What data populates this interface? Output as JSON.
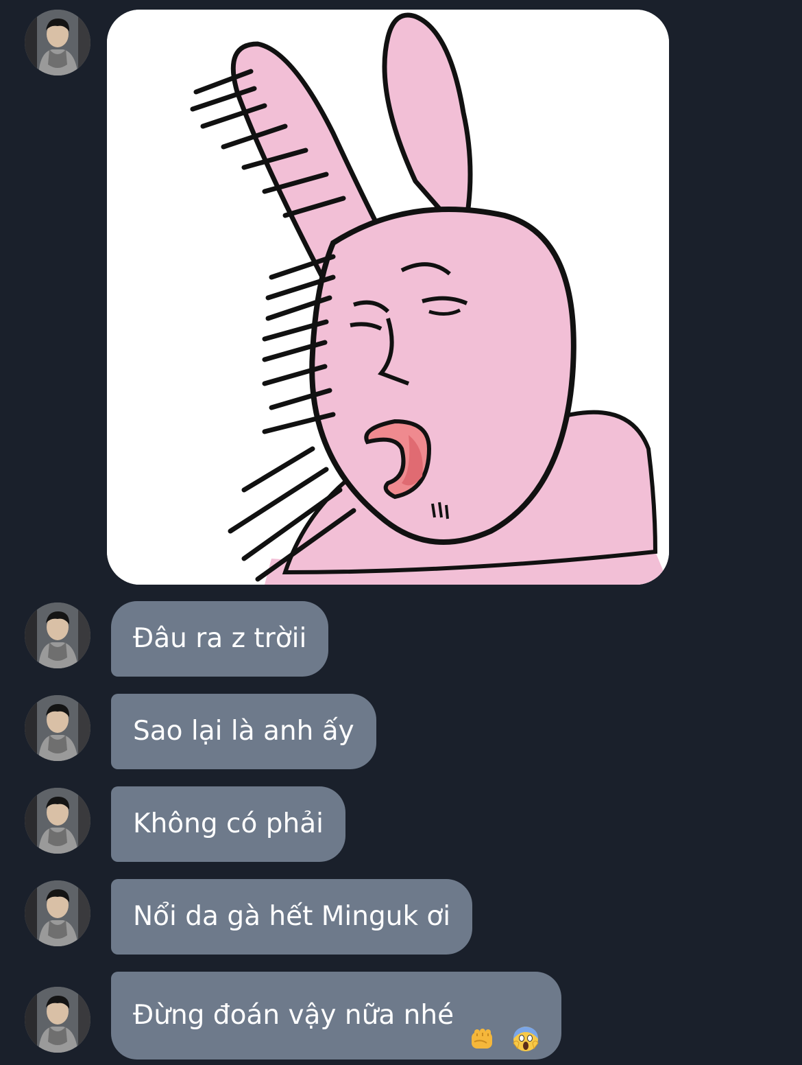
{
  "conversation": {
    "sticker": {
      "icon": "crying-pink-rabbit-sticker"
    },
    "messages": [
      {
        "text": "Đâu ra z trờii"
      },
      {
        "text": "Sao lại là anh ấy"
      },
      {
        "text": "Không có phải"
      },
      {
        "text": "Nổi da gà hết Minguk ơi"
      },
      {
        "text": "Đừng đoán vậy nữa nhé",
        "emojis": [
          "fist-emoji",
          "screaming-face-emoji"
        ]
      }
    ]
  },
  "colors": {
    "background": "#1a202b",
    "bubble": "#6e7a8b",
    "bubble_text": "#ffffff",
    "sticker_pink": "#f2bfd6"
  }
}
